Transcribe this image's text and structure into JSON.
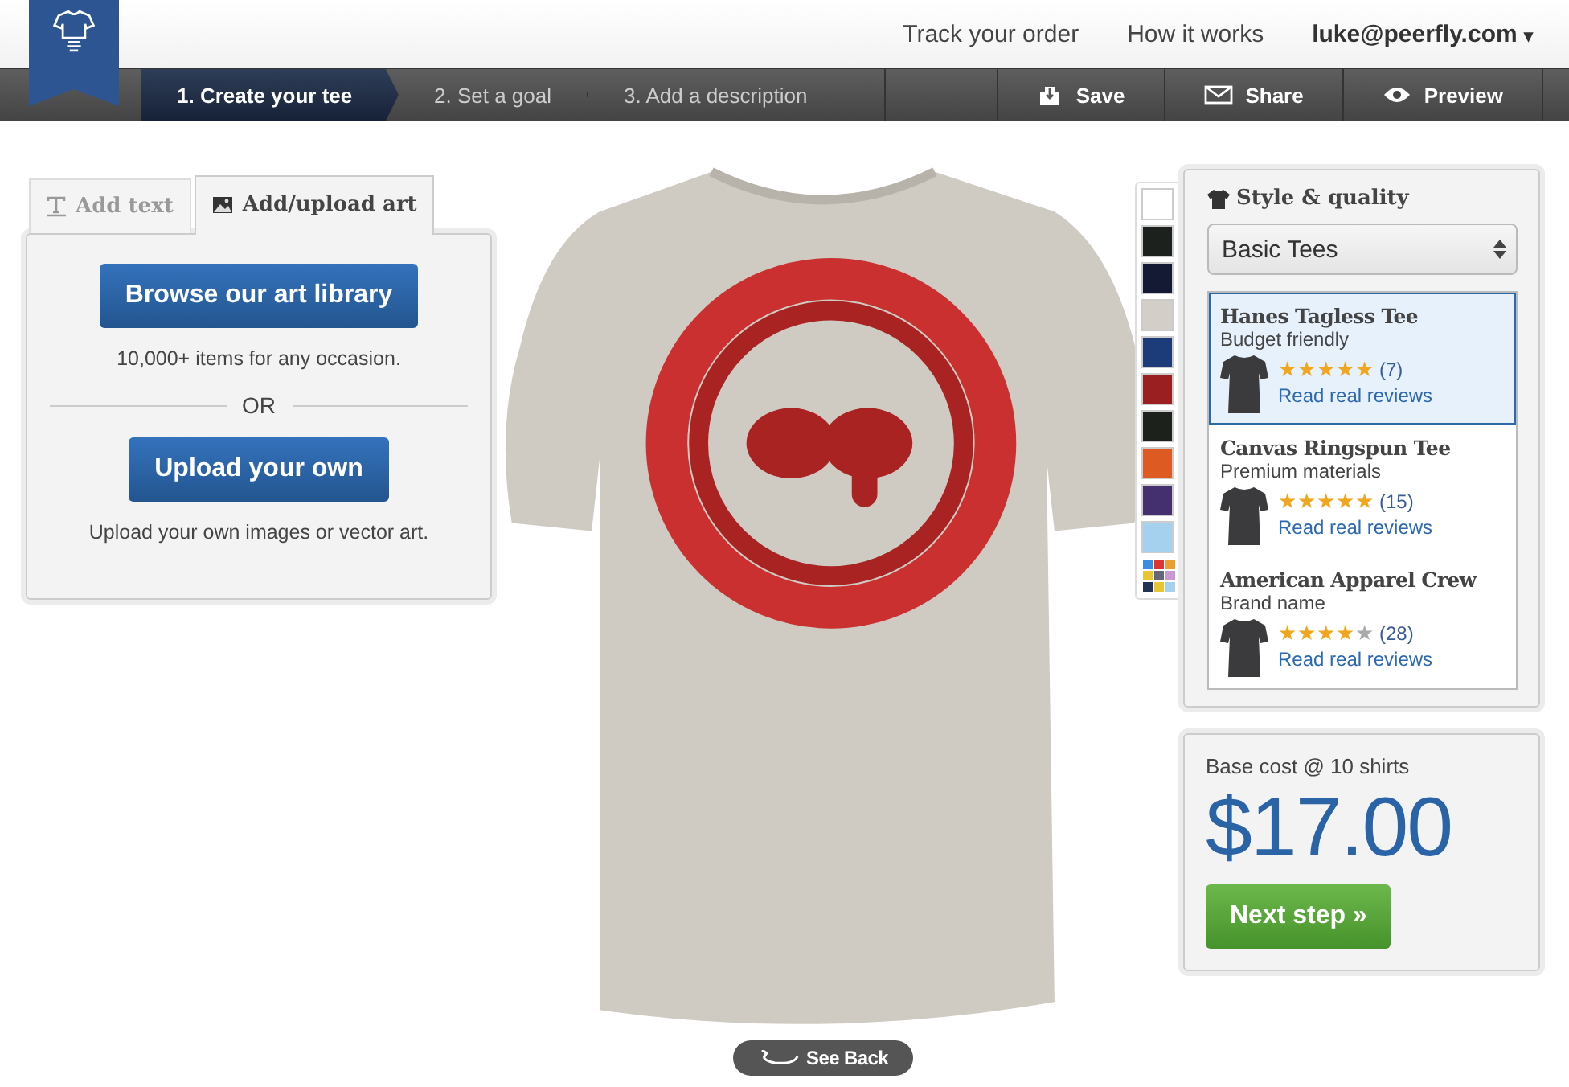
{
  "top_links": [
    {
      "label": "Track your order"
    },
    {
      "label": "How it works"
    }
  ],
  "account": {
    "label": "luke@peerfly.com",
    "caret": "▾"
  },
  "steps": [
    {
      "label": "1. Create your tee",
      "selected": true
    },
    {
      "label": "2. Set a goal",
      "selected": false
    },
    {
      "label": "3. Add a description",
      "selected": false
    }
  ],
  "actions": [
    {
      "label": "Save",
      "kind": "save"
    },
    {
      "label": "Share",
      "kind": "share"
    },
    {
      "label": "Preview",
      "kind": "preview"
    }
  ],
  "design_tabs": [
    {
      "label": "Add text",
      "kind": "text",
      "selected": false
    },
    {
      "label": "Add/upload art",
      "kind": "art",
      "selected": true
    }
  ],
  "art_panel": {
    "browse_button": "Browse our art library",
    "browse_note": "10,000+ items for any occasion.",
    "divider": "OR",
    "upload_button": "Upload your own",
    "upload_note": "Upload your own images or vector art."
  },
  "see_back": "See Back",
  "swatches": [
    {
      "kind": "color",
      "color": "#ffffff"
    },
    {
      "kind": "color",
      "color": "#1c211d"
    },
    {
      "kind": "color",
      "color": "#141a33"
    },
    {
      "kind": "color",
      "color": "#d3cfc8"
    },
    {
      "kind": "color",
      "color": "#1b3c78"
    },
    {
      "kind": "color",
      "color": "#9a1f20"
    },
    {
      "kind": "color",
      "color": "#1d211c"
    },
    {
      "kind": "color",
      "color": "#dd5a22"
    },
    {
      "kind": "color",
      "color": "#44306e"
    },
    {
      "kind": "color",
      "color": "#a5d0ee"
    },
    {
      "kind": "more"
    }
  ],
  "style_panel": {
    "title": "Style & quality",
    "select_value": "Basic Tees",
    "products": [
      {
        "name": "Hanes Tagless Tee",
        "subtitle": "Budget friendly",
        "stars": 5,
        "count": "(7)",
        "link": "Read real reviews",
        "selected": true
      },
      {
        "name": "Canvas Ringspun Tee",
        "subtitle": "Premium materials",
        "stars": 5,
        "count": "(15)",
        "link": "Read real reviews",
        "selected": false
      },
      {
        "name": "American Apparel Crew",
        "subtitle": "Brand name",
        "stars": 4,
        "count": "(28)",
        "link": "Read real reviews",
        "selected": false
      }
    ]
  },
  "price_panel": {
    "label": "Base cost @ 10 shirts",
    "price": "$17.00",
    "next_button": "Next step »"
  }
}
